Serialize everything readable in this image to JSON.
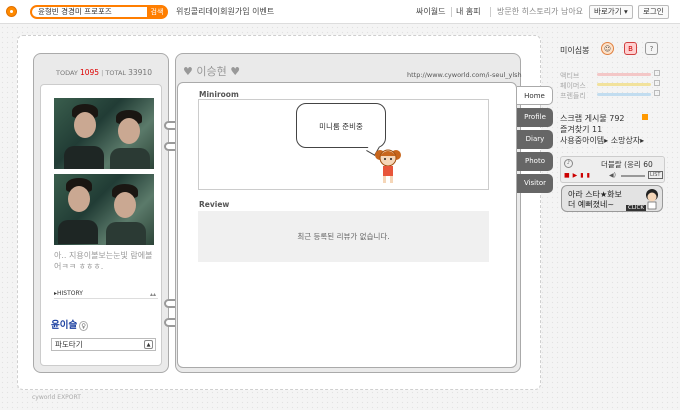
{
  "top": {
    "search_value": "윤형빈 경경미 프로포즈",
    "search_button": "검색",
    "event_link": "위킹콜리데이회원가입 이벤트",
    "links": [
      "싸이월드",
      "내 홈피",
      "방문한 히스토리가 남아요"
    ],
    "dropdown_label": "바로가기",
    "login": "로그인"
  },
  "profile": {
    "today_label": "TODAY",
    "today_count": "1095",
    "total_label": "TOTAL",
    "total_count": "33910",
    "intro": "아.. 지용이볼보는눈빛 람에볼어ㅋㅋ ㅎㅎㅎ.",
    "history_label": "HISTORY",
    "name": "윤이슬",
    "gender": "♀",
    "select_value": "파도타기"
  },
  "homepage": {
    "title": "이승현",
    "url": "http://www.cyworld.com/i-seul_ylsh",
    "miniroom_title": "Miniroom",
    "miniroom_bubble": "미니룸 준비중",
    "review_title": "Review",
    "review_empty": "최근 등록된 리뷰가 없습니다."
  },
  "tabs": [
    "Home",
    "Profile",
    "Diary",
    "Photo",
    "Visitor"
  ],
  "sidebar": {
    "label": "미이심봉",
    "rows": [
      {
        "label": "액티브",
        "color": "#f4c7c7"
      },
      {
        "label": "페이머스",
        "color": "#f2e29c"
      },
      {
        "label": "프렌들리",
        "color": "#c2ddf0"
      }
    ],
    "scrap": "스크랩 게시물 792",
    "favorites": "즐겨찾기 11",
    "shop": "사용중아이템▸ 소망상자▸",
    "player_title": "더블랄 (응리 60",
    "ad_line1": "아라 스타★화보",
    "ad_line2": "더 예뻐졌네~",
    "ad_click": "CLICK"
  },
  "footer": "cyworld EXPORT",
  "colors": {
    "accent": "#ff7e00",
    "tab_bg": "#666666",
    "name": "#1a3fa0"
  }
}
